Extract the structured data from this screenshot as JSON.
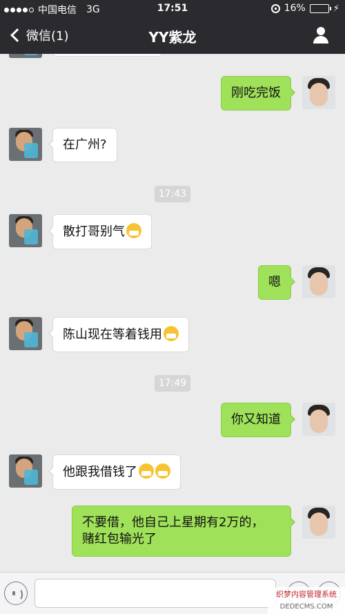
{
  "status_bar": {
    "carrier": "中国电信",
    "network": "3G",
    "time": "17:51",
    "battery": "16%",
    "battery_level": 0.16,
    "signal_bars": 4
  },
  "nav": {
    "back_label": "微信(1)",
    "title": "YY紫龙",
    "profile_icon": "person-icon"
  },
  "messages": [
    {
      "side": "right",
      "text": "刚吃完饭",
      "emoji_count": 0
    },
    {
      "side": "left",
      "text": "在广州?",
      "emoji_count": 0
    },
    {
      "type": "timestamp",
      "text": "17:43"
    },
    {
      "side": "left",
      "text": "散打哥别气",
      "emoji_count": 1
    },
    {
      "side": "right",
      "text": "嗯",
      "emoji_count": 0
    },
    {
      "side": "left",
      "text": "陈山现在等着钱用",
      "emoji_count": 1
    },
    {
      "type": "timestamp",
      "text": "17:49"
    },
    {
      "side": "right",
      "text": "你又知道",
      "emoji_count": 0
    },
    {
      "side": "left",
      "text": "他跟我借钱了",
      "emoji_count": 2
    },
    {
      "side": "right",
      "text_line1": "不要借，他自己上星期有2万的，",
      "text_line2": "赌红包输光了",
      "emoji_count": 0
    }
  ],
  "emoji_name": "mask-face-emoji",
  "input_bar": {
    "voice_icon": "voice-icon",
    "emoji_icon": "emoji-icon",
    "plus_icon": "plus-icon",
    "text": ""
  },
  "watermark": {
    "line1": "织梦内容管理系统",
    "line2": "DEDECMS.COM"
  }
}
